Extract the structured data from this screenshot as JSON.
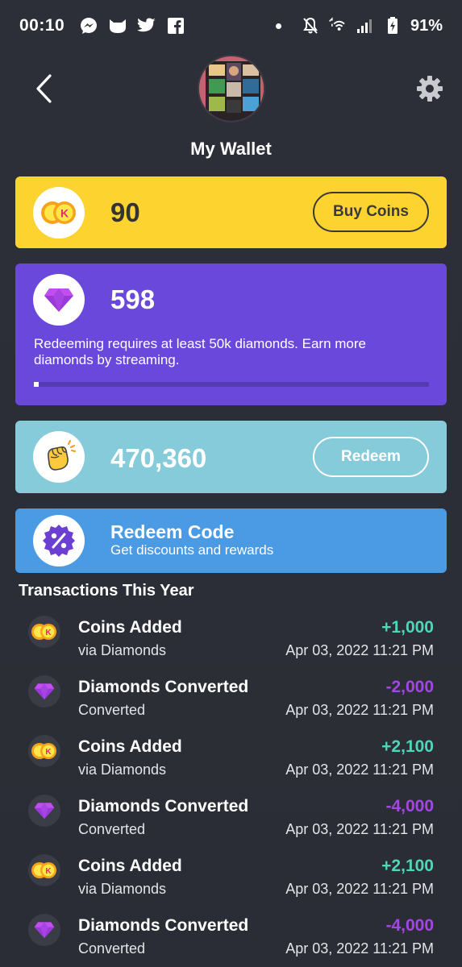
{
  "status_bar": {
    "time": "00:10",
    "battery": "91%",
    "icons": [
      "messenger-icon",
      "kiwi-icon",
      "twitter-icon",
      "facebook-icon",
      "notification-dot",
      "mute-icon",
      "wifi-icon",
      "signal-icon",
      "battery-icon"
    ]
  },
  "header": {
    "title": "My Wallet",
    "back_icon": "back-arrow-icon",
    "settings_icon": "gear-icon"
  },
  "coins": {
    "amount": "90",
    "button_label": "Buy Coins",
    "icon": "coins-icon"
  },
  "diamonds": {
    "amount": "598",
    "note": "Redeeming requires at least 50k diamonds. Earn more diamonds by streaming.",
    "progress": 0.012,
    "icon": "diamond-icon"
  },
  "beans": {
    "amount": "470,360",
    "button_label": "Redeem",
    "icon": "fist-icon"
  },
  "redeem_code": {
    "title": "Redeem Code",
    "subtitle": "Get discounts and rewards",
    "icon": "percent-badge-icon"
  },
  "transactions": {
    "title": "Transactions This Year",
    "items": [
      {
        "type": "coins",
        "title": "Coins Added",
        "sub": "via Diamonds",
        "amount": "+1,000",
        "date": "Apr 03, 2022 11:21 PM"
      },
      {
        "type": "diamonds",
        "title": "Diamonds Converted",
        "sub": "Converted",
        "amount": "-2,000",
        "date": "Apr 03, 2022 11:21 PM"
      },
      {
        "type": "coins",
        "title": "Coins Added",
        "sub": "via Diamonds",
        "amount": "+2,100",
        "date": "Apr 03, 2022 11:21 PM"
      },
      {
        "type": "diamonds",
        "title": "Diamonds Converted",
        "sub": "Converted",
        "amount": "-4,000",
        "date": "Apr 03, 2022 11:21 PM"
      },
      {
        "type": "coins",
        "title": "Coins Added",
        "sub": "via Diamonds",
        "amount": "+2,100",
        "date": "Apr 03, 2022 11:21 PM"
      },
      {
        "type": "diamonds",
        "title": "Diamonds Converted",
        "sub": "Converted",
        "amount": "-4,000",
        "date": "Apr 03, 2022 11:21 PM"
      }
    ]
  },
  "colors": {
    "background": "#2d2f38",
    "coins_card": "#fdd42f",
    "diamonds_card": "#6a48db",
    "beans_card": "#85cbda",
    "code_card": "#4a9be3",
    "positive": "#4fd6b8",
    "negative": "#a445e6"
  }
}
